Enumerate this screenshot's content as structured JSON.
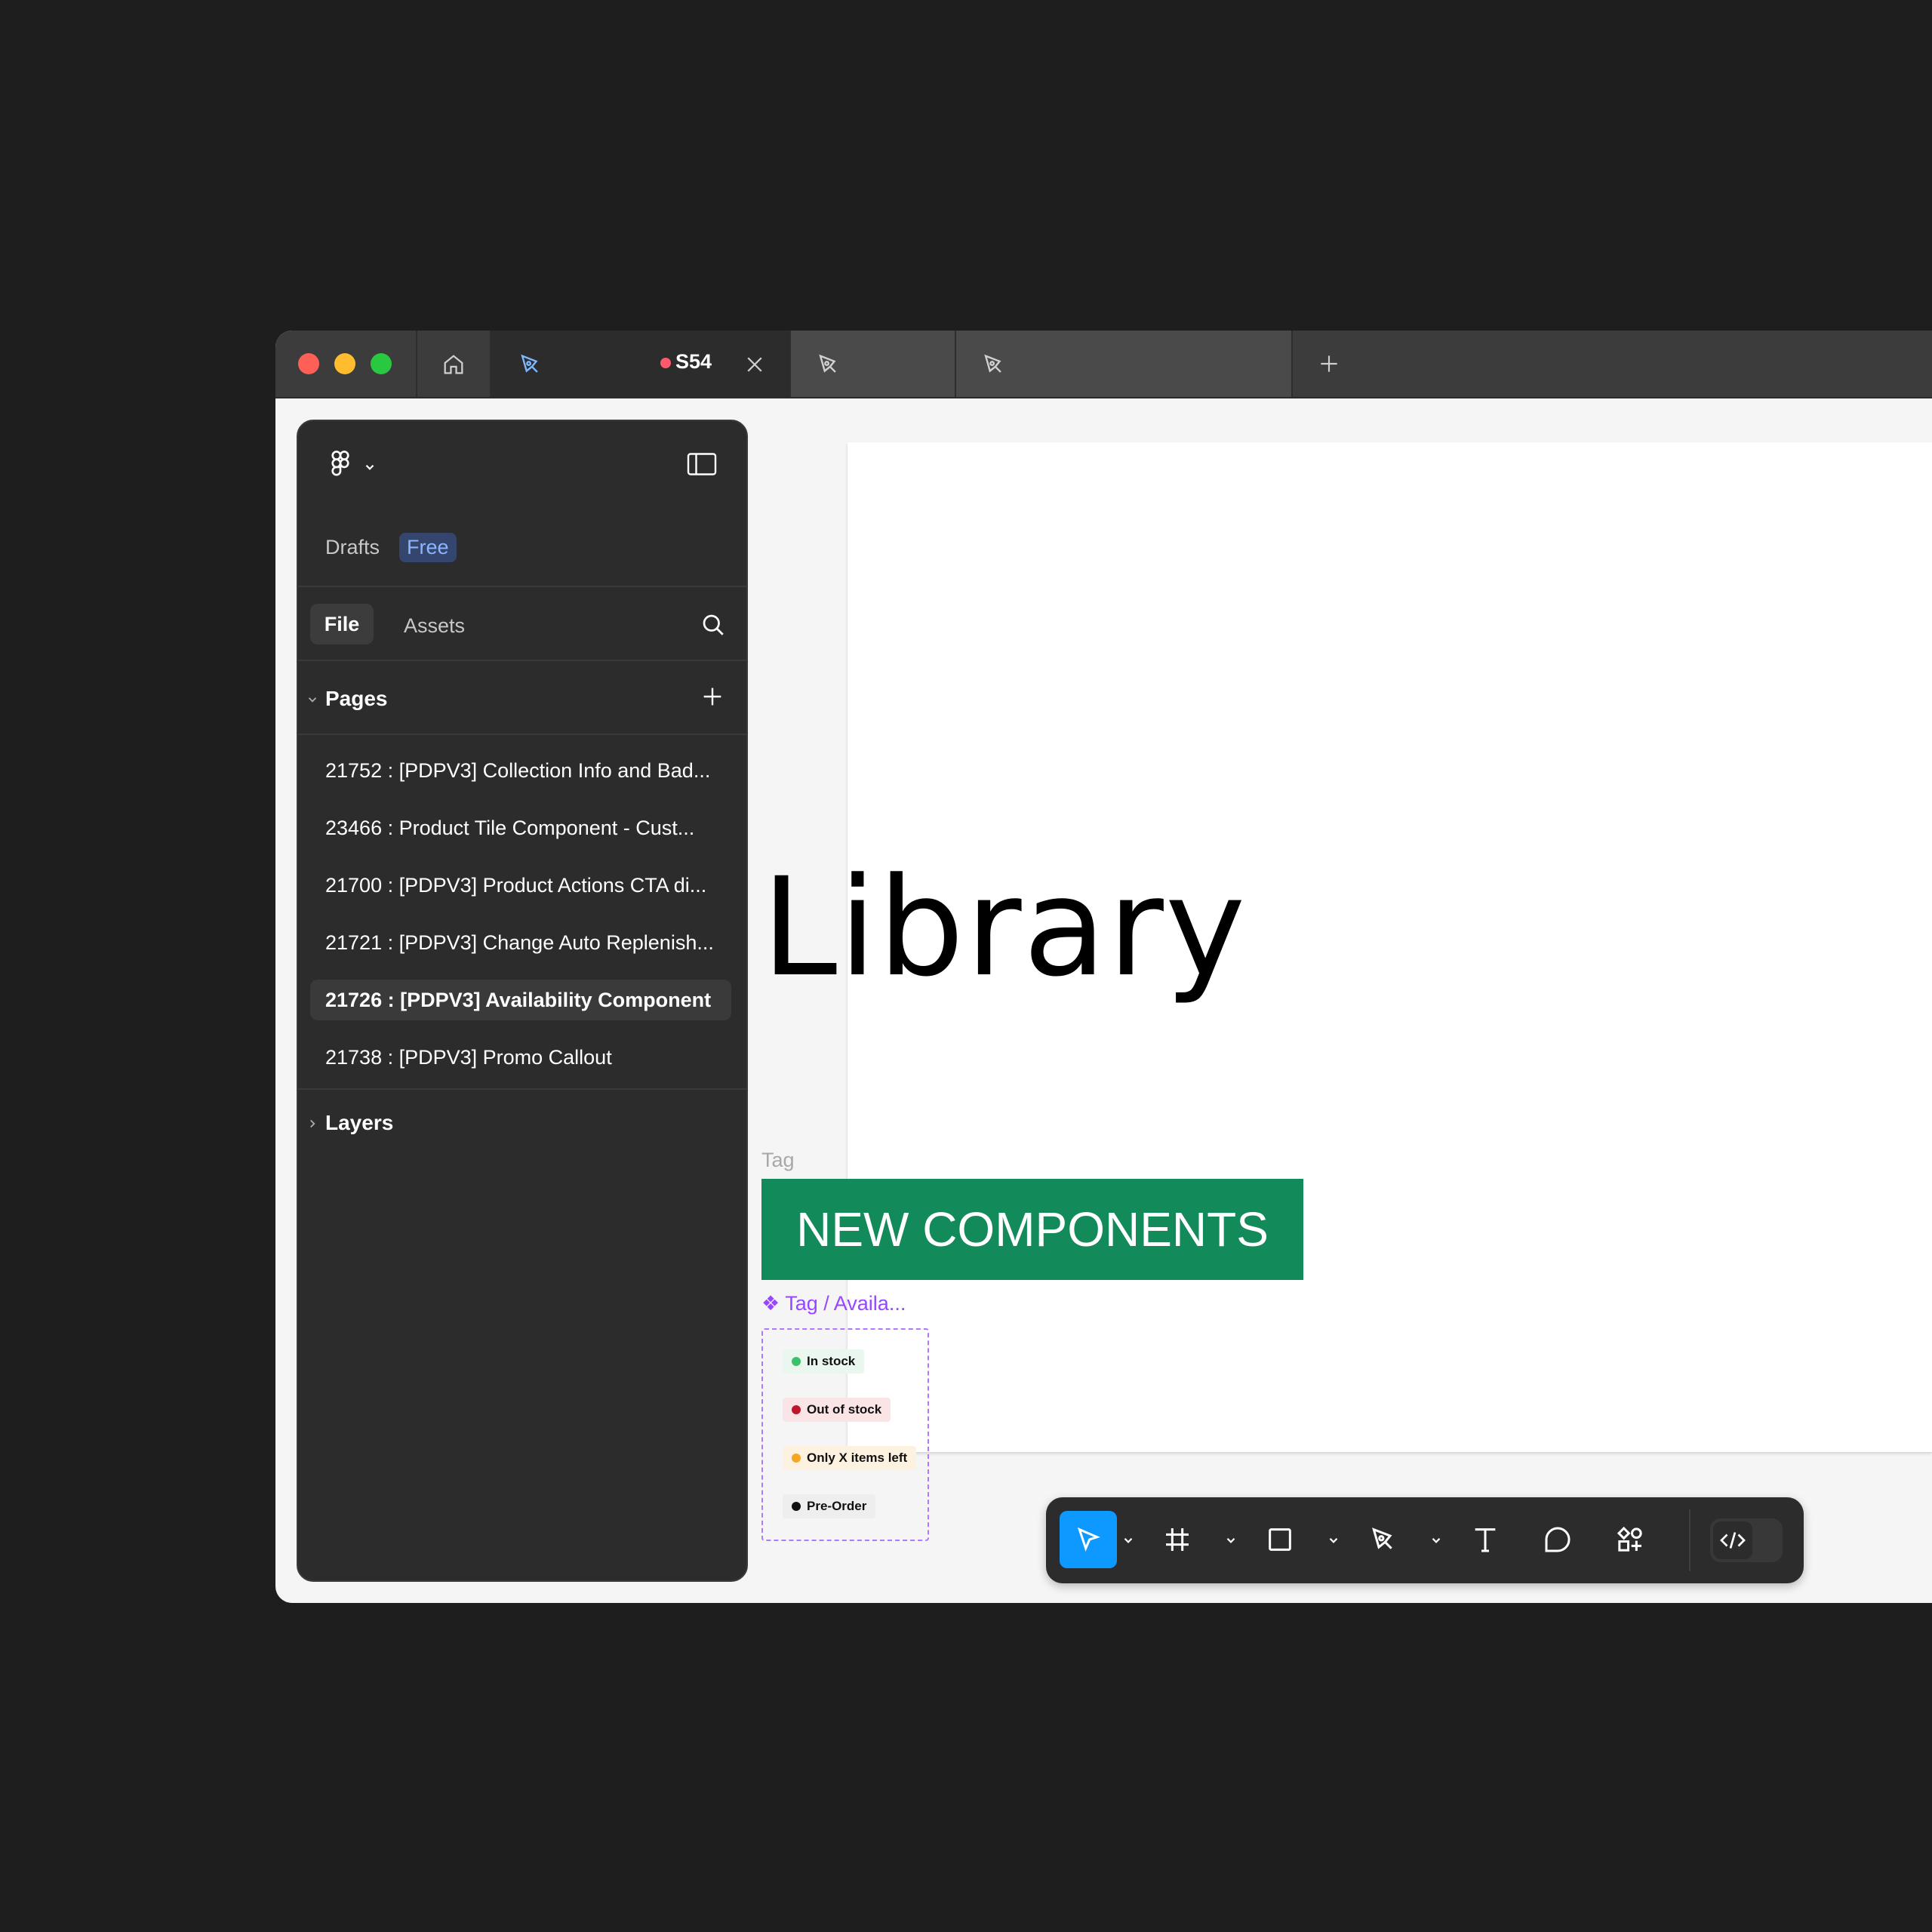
{
  "window": {
    "tabs": {
      "home": "home-icon",
      "active_title": "S54",
      "new_tab": "plus-icon"
    }
  },
  "sidebar": {
    "team": "Drafts",
    "plan_badge": "Free",
    "tabs": {
      "file": "File",
      "assets": "Assets"
    },
    "pages_label": "Pages",
    "pages": [
      {
        "label": "21752 : [PDPV3] Collection Info and Bad..."
      },
      {
        "label": "23466 : Product Tile Component - Cust..."
      },
      {
        "label": "21700 : [PDPV3] Product Actions CTA di..."
      },
      {
        "label": "21721 : [PDPV3] Change Auto Replenish..."
      },
      {
        "label": "21726 : [PDPV3] Availability Component",
        "selected": true
      },
      {
        "label": "21738 : [PDPV3] Promo Callout"
      }
    ],
    "layers_label": "Layers"
  },
  "canvas": {
    "title": "Library",
    "tag_label": "Tag",
    "banner": "NEW COMPONENTS",
    "component_label": "❖ Tag / Availa...",
    "chips": [
      {
        "label": "In stock",
        "dot": "#3cc06a",
        "bg": "#eaf7ee"
      },
      {
        "label": "Out of stock",
        "dot": "#c0162b",
        "bg": "#fbe4e6"
      },
      {
        "label": "Only X items left",
        "dot": "#f5a623",
        "bg": "#fdf1e0"
      },
      {
        "label": "Pre-Order",
        "dot": "#111111",
        "bg": "#eeeeee"
      }
    ]
  },
  "toolbar": {
    "tools": [
      "move-icon",
      "frame-icon",
      "rectangle-icon",
      "pen-icon",
      "text-icon",
      "comment-icon",
      "actions-icon"
    ],
    "dev_mode": "code-icon"
  },
  "colors": {
    "accent": "#0d99ff",
    "banner": "#128a5a",
    "component": "#9747ff"
  }
}
